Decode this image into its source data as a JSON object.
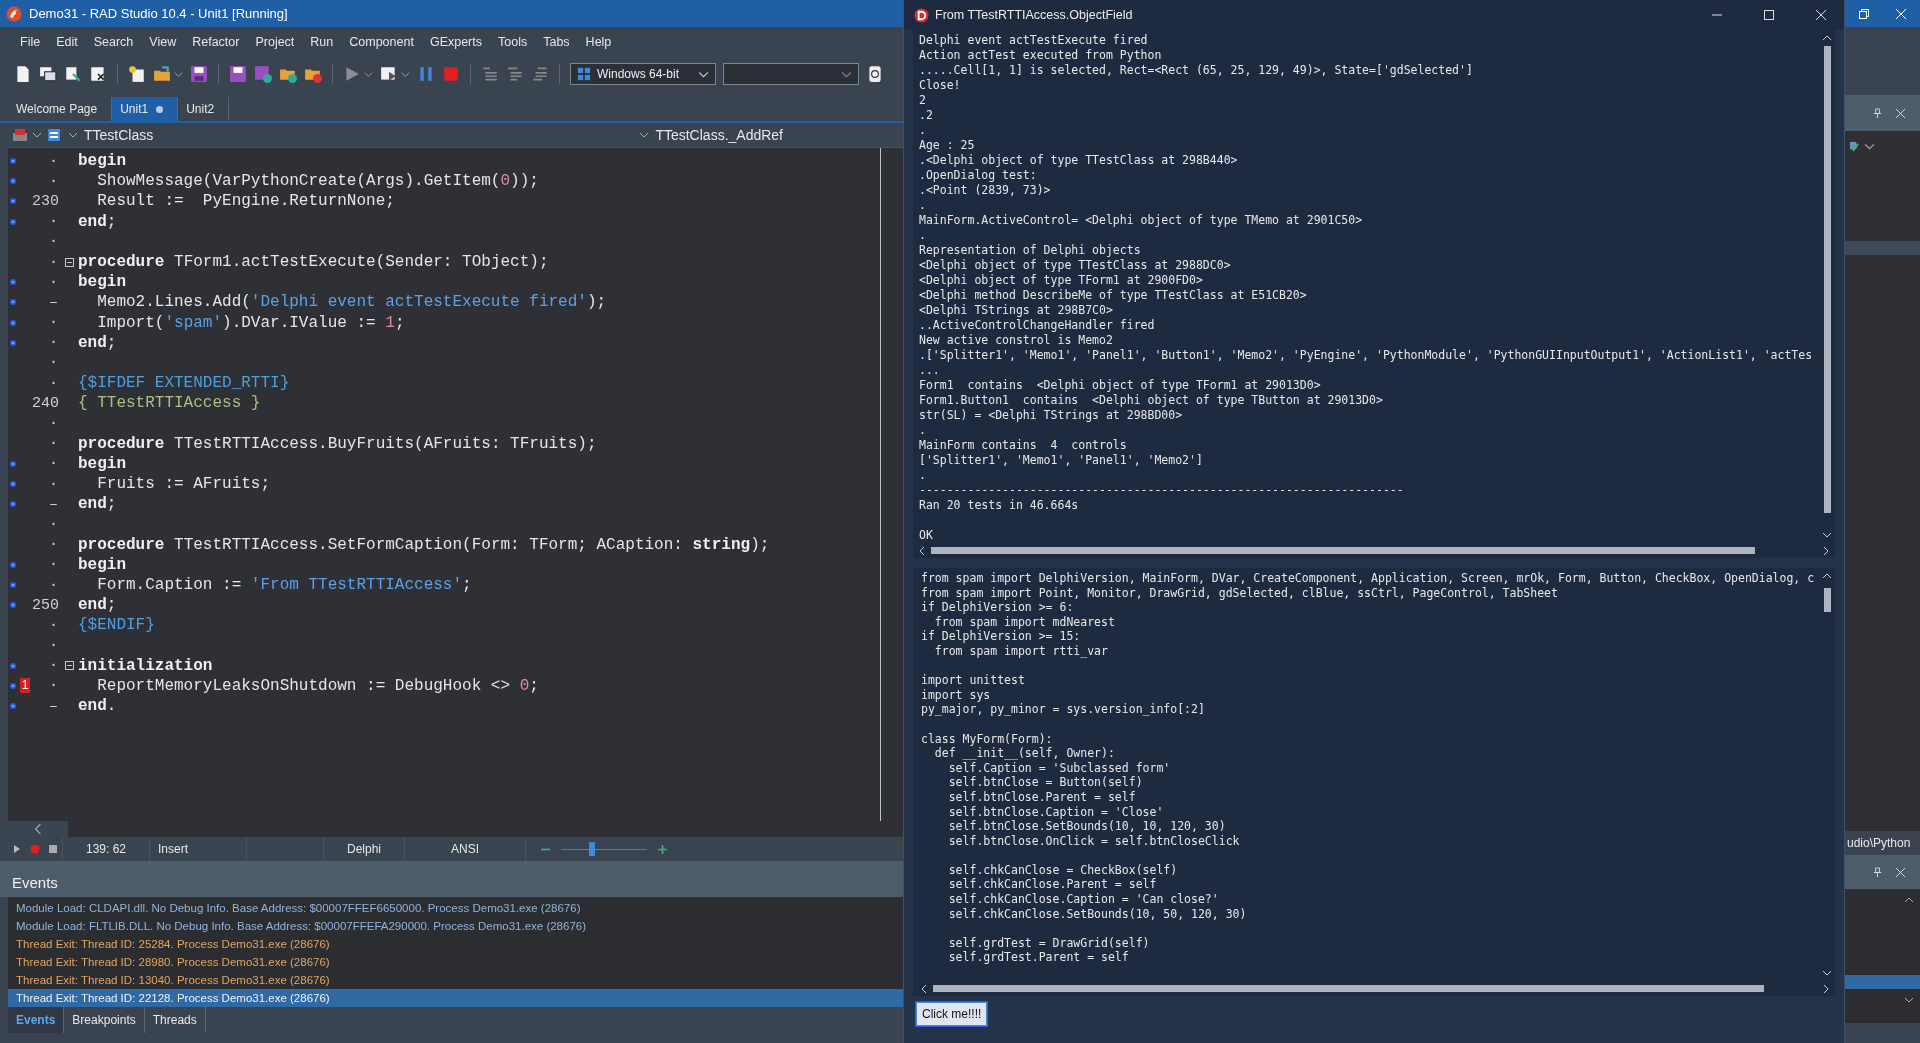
{
  "ide": {
    "title": "Demo31 - RAD Studio 10.4 - Unit1 [Running]",
    "menu": [
      "File",
      "Edit",
      "Search",
      "View",
      "Refactor",
      "Project",
      "Run",
      "Component",
      "GExperts",
      "Tools",
      "Tabs",
      "Help"
    ],
    "platform": "Windows 64-bit",
    "tabs": [
      {
        "label": "Welcome Page",
        "selected": false,
        "modified": false
      },
      {
        "label": "Unit1",
        "selected": true,
        "modified": true
      },
      {
        "label": "Unit2",
        "selected": false,
        "modified": false
      }
    ],
    "editor": {
      "class_box": "TTestClass",
      "method_box": "TTestClass._AddRef",
      "lines": [
        {
          "gutter": "·",
          "exec": true,
          "fold_start": false,
          "tokens": [
            {
              "kind": "keyword",
              "text": "begin"
            }
          ]
        },
        {
          "gutter": "·",
          "exec": true,
          "fold_start": false,
          "tokens": [
            {
              "kind": "plain",
              "text": "  ShowMessage(VarPythonCreate(Args).GetItem("
            },
            {
              "kind": "number",
              "text": "0"
            },
            {
              "kind": "plain",
              "text": "));"
            }
          ]
        },
        {
          "gutter": "230",
          "exec": true,
          "fold_start": false,
          "tokens": [
            {
              "kind": "plain",
              "text": "  Result :=  PyEngine.ReturnNone;"
            }
          ]
        },
        {
          "gutter": "·",
          "exec": true,
          "fold_start": false,
          "tokens": [
            {
              "kind": "keyword",
              "text": "end"
            },
            {
              "kind": "plain",
              "text": ";"
            }
          ]
        },
        {
          "gutter": "·",
          "exec": false,
          "fold_start": false
        },
        {
          "gutter": "·",
          "exec": false,
          "fold_start": true,
          "tokens": [
            {
              "kind": "keyword",
              "text": "procedure"
            },
            {
              "kind": "plain",
              "text": " TForm1.actTestExecute(Sender: TObject);"
            }
          ]
        },
        {
          "gutter": "·",
          "exec": true,
          "fold_start": false,
          "tokens": [
            {
              "kind": "keyword",
              "text": "begin"
            }
          ]
        },
        {
          "gutter": "–",
          "exec": true,
          "fold_start": false,
          "tokens": [
            {
              "kind": "plain",
              "text": "  Memo2.Lines.Add("
            },
            {
              "kind": "string",
              "text": "'Delphi event actTestExecute fired'"
            },
            {
              "kind": "plain",
              "text": ");"
            }
          ]
        },
        {
          "gutter": "·",
          "exec": true,
          "fold_start": false,
          "tokens": [
            {
              "kind": "plain",
              "text": "  Import("
            },
            {
              "kind": "string",
              "text": "'spam'"
            },
            {
              "kind": "plain",
              "text": ").DVar.IValue := "
            },
            {
              "kind": "number",
              "text": "1"
            },
            {
              "kind": "plain",
              "text": ";"
            }
          ]
        },
        {
          "gutter": "·",
          "exec": true,
          "fold_start": false,
          "tokens": [
            {
              "kind": "keyword",
              "text": "end"
            },
            {
              "kind": "plain",
              "text": ";"
            }
          ]
        },
        {
          "gutter": "·",
          "exec": false,
          "fold_start": false
        },
        {
          "gutter": "·",
          "exec": false,
          "fold_start": false,
          "tokens": [
            {
              "kind": "directive",
              "text": "{$IFDEF EXTENDED_RTTI}"
            }
          ]
        },
        {
          "gutter": "240",
          "exec": false,
          "fold_start": false,
          "tokens": [
            {
              "kind": "comment",
              "text": "{ TTestRTTIAccess }"
            }
          ]
        },
        {
          "gutter": "·",
          "exec": false,
          "fold_start": false
        },
        {
          "gutter": "·",
          "exec": false,
          "fold_start": false,
          "tokens": [
            {
              "kind": "keyword",
              "text": "procedure"
            },
            {
              "kind": "plain",
              "text": " TTestRTTIAccess.BuyFruits(AFruits: TFruits);"
            }
          ]
        },
        {
          "gutter": "·",
          "exec": true,
          "fold_start": false,
          "tokens": [
            {
              "kind": "keyword",
              "text": "begin"
            }
          ]
        },
        {
          "gutter": "·",
          "exec": true,
          "fold_start": false,
          "tokens": [
            {
              "kind": "plain",
              "text": "  Fruits := AFruits;"
            }
          ]
        },
        {
          "gutter": "–",
          "exec": true,
          "fold_start": false,
          "tokens": [
            {
              "kind": "keyword",
              "text": "end"
            },
            {
              "kind": "plain",
              "text": ";"
            }
          ]
        },
        {
          "gutter": "·",
          "exec": false,
          "fold_start": false
        },
        {
          "gutter": "·",
          "exec": false,
          "fold_start": false,
          "tokens": [
            {
              "kind": "keyword",
              "text": "procedure"
            },
            {
              "kind": "plain",
              "text": " TTestRTTIAccess.SetFormCaption(Form: TForm; ACaption: "
            },
            {
              "kind": "keyword",
              "text": "string"
            },
            {
              "kind": "plain",
              "text": ");"
            }
          ]
        },
        {
          "gutter": "·",
          "exec": true,
          "fold_start": false,
          "tokens": [
            {
              "kind": "keyword",
              "text": "begin"
            }
          ]
        },
        {
          "gutter": "·",
          "exec": true,
          "fold_start": false,
          "tokens": [
            {
              "kind": "plain",
              "text": "  Form.Caption := "
            },
            {
              "kind": "string",
              "text": "'From TTestRTTIAccess'"
            },
            {
              "kind": "plain",
              "text": ";"
            }
          ]
        },
        {
          "gutter": "250",
          "exec": true,
          "fold_start": false,
          "tokens": [
            {
              "kind": "keyword",
              "text": "end"
            },
            {
              "kind": "plain",
              "text": ";"
            }
          ]
        },
        {
          "gutter": "·",
          "exec": false,
          "fold_start": false,
          "tokens": [
            {
              "kind": "directive",
              "text": "{$ENDIF}"
            }
          ]
        },
        {
          "gutter": "·",
          "exec": false,
          "fold_start": false
        },
        {
          "gutter": "·",
          "exec": true,
          "fold_start": true,
          "tokens": [
            {
              "kind": "keyword",
              "text": "initialization"
            }
          ]
        },
        {
          "gutter": "·",
          "exec": true,
          "fold_start": false,
          "bookmark": "1",
          "tokens": [
            {
              "kind": "plain",
              "text": "  ReportMemoryLeaksOnShutdown := DebugHook <> "
            },
            {
              "kind": "number",
              "text": "0"
            },
            {
              "kind": "plain",
              "text": ";"
            }
          ]
        },
        {
          "gutter": "–",
          "exec": true,
          "fold_start": false,
          "tokens": [
            {
              "kind": "keyword",
              "text": "end"
            },
            {
              "kind": "plain",
              "text": "."
            }
          ]
        }
      ]
    },
    "status_bar": {
      "position": "139: 62",
      "mode": "Insert",
      "language": "Delphi",
      "encoding": "ANSI",
      "zoom": {
        "level": 0.32
      }
    },
    "events": {
      "title": "Events",
      "rows": [
        {
          "kind": "module",
          "text": "Module Load: CLDAPI.dll. No Debug Info. Base Address: $00007FFEF6650000. Process Demo31.exe (28676)",
          "selected": false
        },
        {
          "kind": "module",
          "text": "Module Load: FLTLIB.DLL. No Debug Info. Base Address: $00007FFEFA290000. Process Demo31.exe (28676)",
          "selected": false
        },
        {
          "kind": "thread",
          "text": "Thread Exit: Thread ID: 25284. Process Demo31.exe (28676)",
          "selected": false
        },
        {
          "kind": "thread",
          "text": "Thread Exit: Thread ID: 28980. Process Demo31.exe (28676)",
          "selected": false
        },
        {
          "kind": "thread",
          "text": "Thread Exit: Thread ID: 13040. Process Demo31.exe (28676)",
          "selected": false
        },
        {
          "kind": "thread",
          "text": "Thread Exit: Thread ID: 22128. Process Demo31.exe (28676)",
          "selected": true
        }
      ],
      "tabs": [
        {
          "label": "Events",
          "selected": true
        },
        {
          "label": "Breakpoints",
          "selected": false
        },
        {
          "label": "Threads",
          "selected": false
        }
      ]
    },
    "right_edge": {
      "path": "udio\\Python"
    }
  },
  "python_window": {
    "title": "From TTestRTTIAccess.ObjectField",
    "output": [
      [
        "Delphi event actTestExecute fired",
        "Action actTest executed from Python",
        ".....Cell[1, 1] is selected, Rect=<Rect (65, 25, 129, 49)>, State=['gdSelected']",
        "Close!",
        "2",
        ".2",
        ".",
        "Age : 25",
        ".<Delphi object of type TTestClass at 298B440>",
        ".OpenDialog test:",
        ".<Point (2839, 73)>",
        ".",
        "MainForm.ActiveControl= <Delphi object of type TMemo at 2901C50>",
        ".",
        "Representation of Delphi objects",
        "<Delphi object of type TTestClass at 2988DC0>",
        "<Delphi object of type TForm1 at 2900FD0>",
        "<Delphi method DescribeMe of type TTestClass at E51CB20>",
        "<Delphi TStrings at 298B7C0>",
        "..ActiveControlChangeHandler fired",
        "New active constrol is Memo2",
        ".['Splitter1', 'Memo1', 'Panel1', 'Button1', 'Memo2', 'PyEngine', 'PythonModule', 'PythonGUIInputOutput1', 'ActionList1', 'actTes",
        "...",
        "Form1  contains  <Delphi object of type TForm1 at 29013D0>",
        "Form1.Button1  contains  <Delphi object of type TButton at 29013D0>",
        "str(SL) = <Delphi TStrings at 298BD00>",
        ".",
        "MainForm contains  4  controls",
        "['Splitter1', 'Memo1', 'Panel1', 'Memo2']",
        ".",
        "----------------------------------------------------------------------",
        "Ran 20 tests in 46.664s"
      ],
      [
        "OK"
      ]
    ],
    "code": [
      [
        "from spam import DelphiVersion, MainForm, DVar, CreateComponent, Application, Screen, mrOk, Form, Button, CheckBox, OpenDialog, c",
        "from spam import Point, Monitor, DrawGrid, gdSelected, clBlue, ssCtrl, PageControl, TabSheet",
        "if DelphiVersion >= 6:",
        "  from spam import mdNearest",
        "if DelphiVersion >= 15:",
        "  from spam import rtti_var"
      ],
      [
        "import unittest",
        "import sys",
        "py_major, py_minor = sys.version_info[:2]"
      ],
      [
        "class MyForm(Form):",
        "  def __init__(self, Owner):",
        "    self.Caption = 'Subclassed form'",
        "    self.btnClose = Button(self)",
        "    self.btnClose.Parent = self",
        "    self.btnClose.Caption = 'Close'",
        "    self.btnClose.SetBounds(10, 10, 120, 30)",
        "    self.btnClose.OnClick = self.btnCloseClick"
      ],
      [
        "    self.chkCanClose = CheckBox(self)",
        "    self.chkCanClose.Parent = self",
        "    self.chkCanClose.Caption = 'Can close?'",
        "    self.chkCanClose.SetBounds(10, 50, 120, 30)"
      ],
      [
        "    self.grdTest = DrawGrid(self)",
        "    self.grdTest.Parent = self"
      ]
    ],
    "button": "Click me!!!!"
  }
}
